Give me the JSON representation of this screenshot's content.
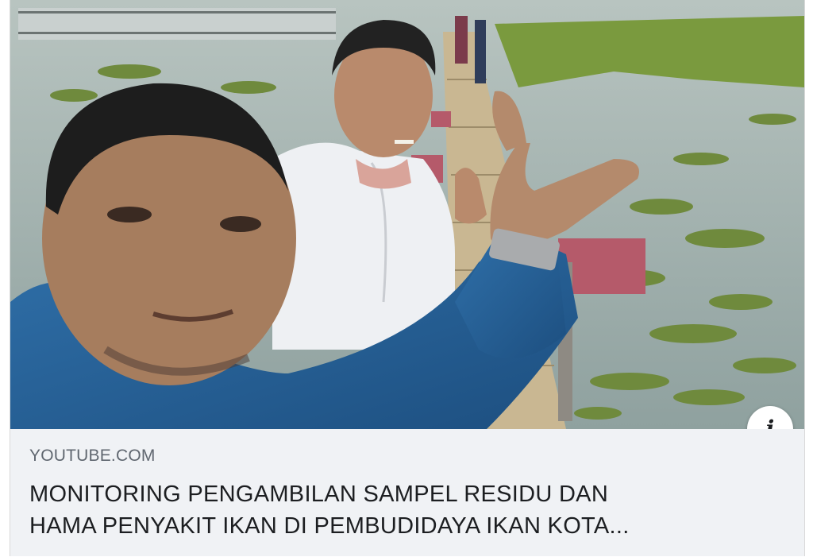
{
  "link_preview": {
    "thumbnail_alt": "Two men taking a selfie on a wooden walkway over fish ponds",
    "info_icon": "info-icon",
    "info_glyph": "i",
    "domain": "YOUTUBE.COM",
    "title_line1": "MONITORING PENGAMBILAN SAMPEL RESIDU DAN",
    "title_line2": "HAMA PENYAKIT IKAN DI PEMBUDIDAYA IKAN KOTA..."
  },
  "colors": {
    "meta_background": "#f0f2f5",
    "domain_text": "#606770",
    "title_text": "#1c1e21"
  }
}
